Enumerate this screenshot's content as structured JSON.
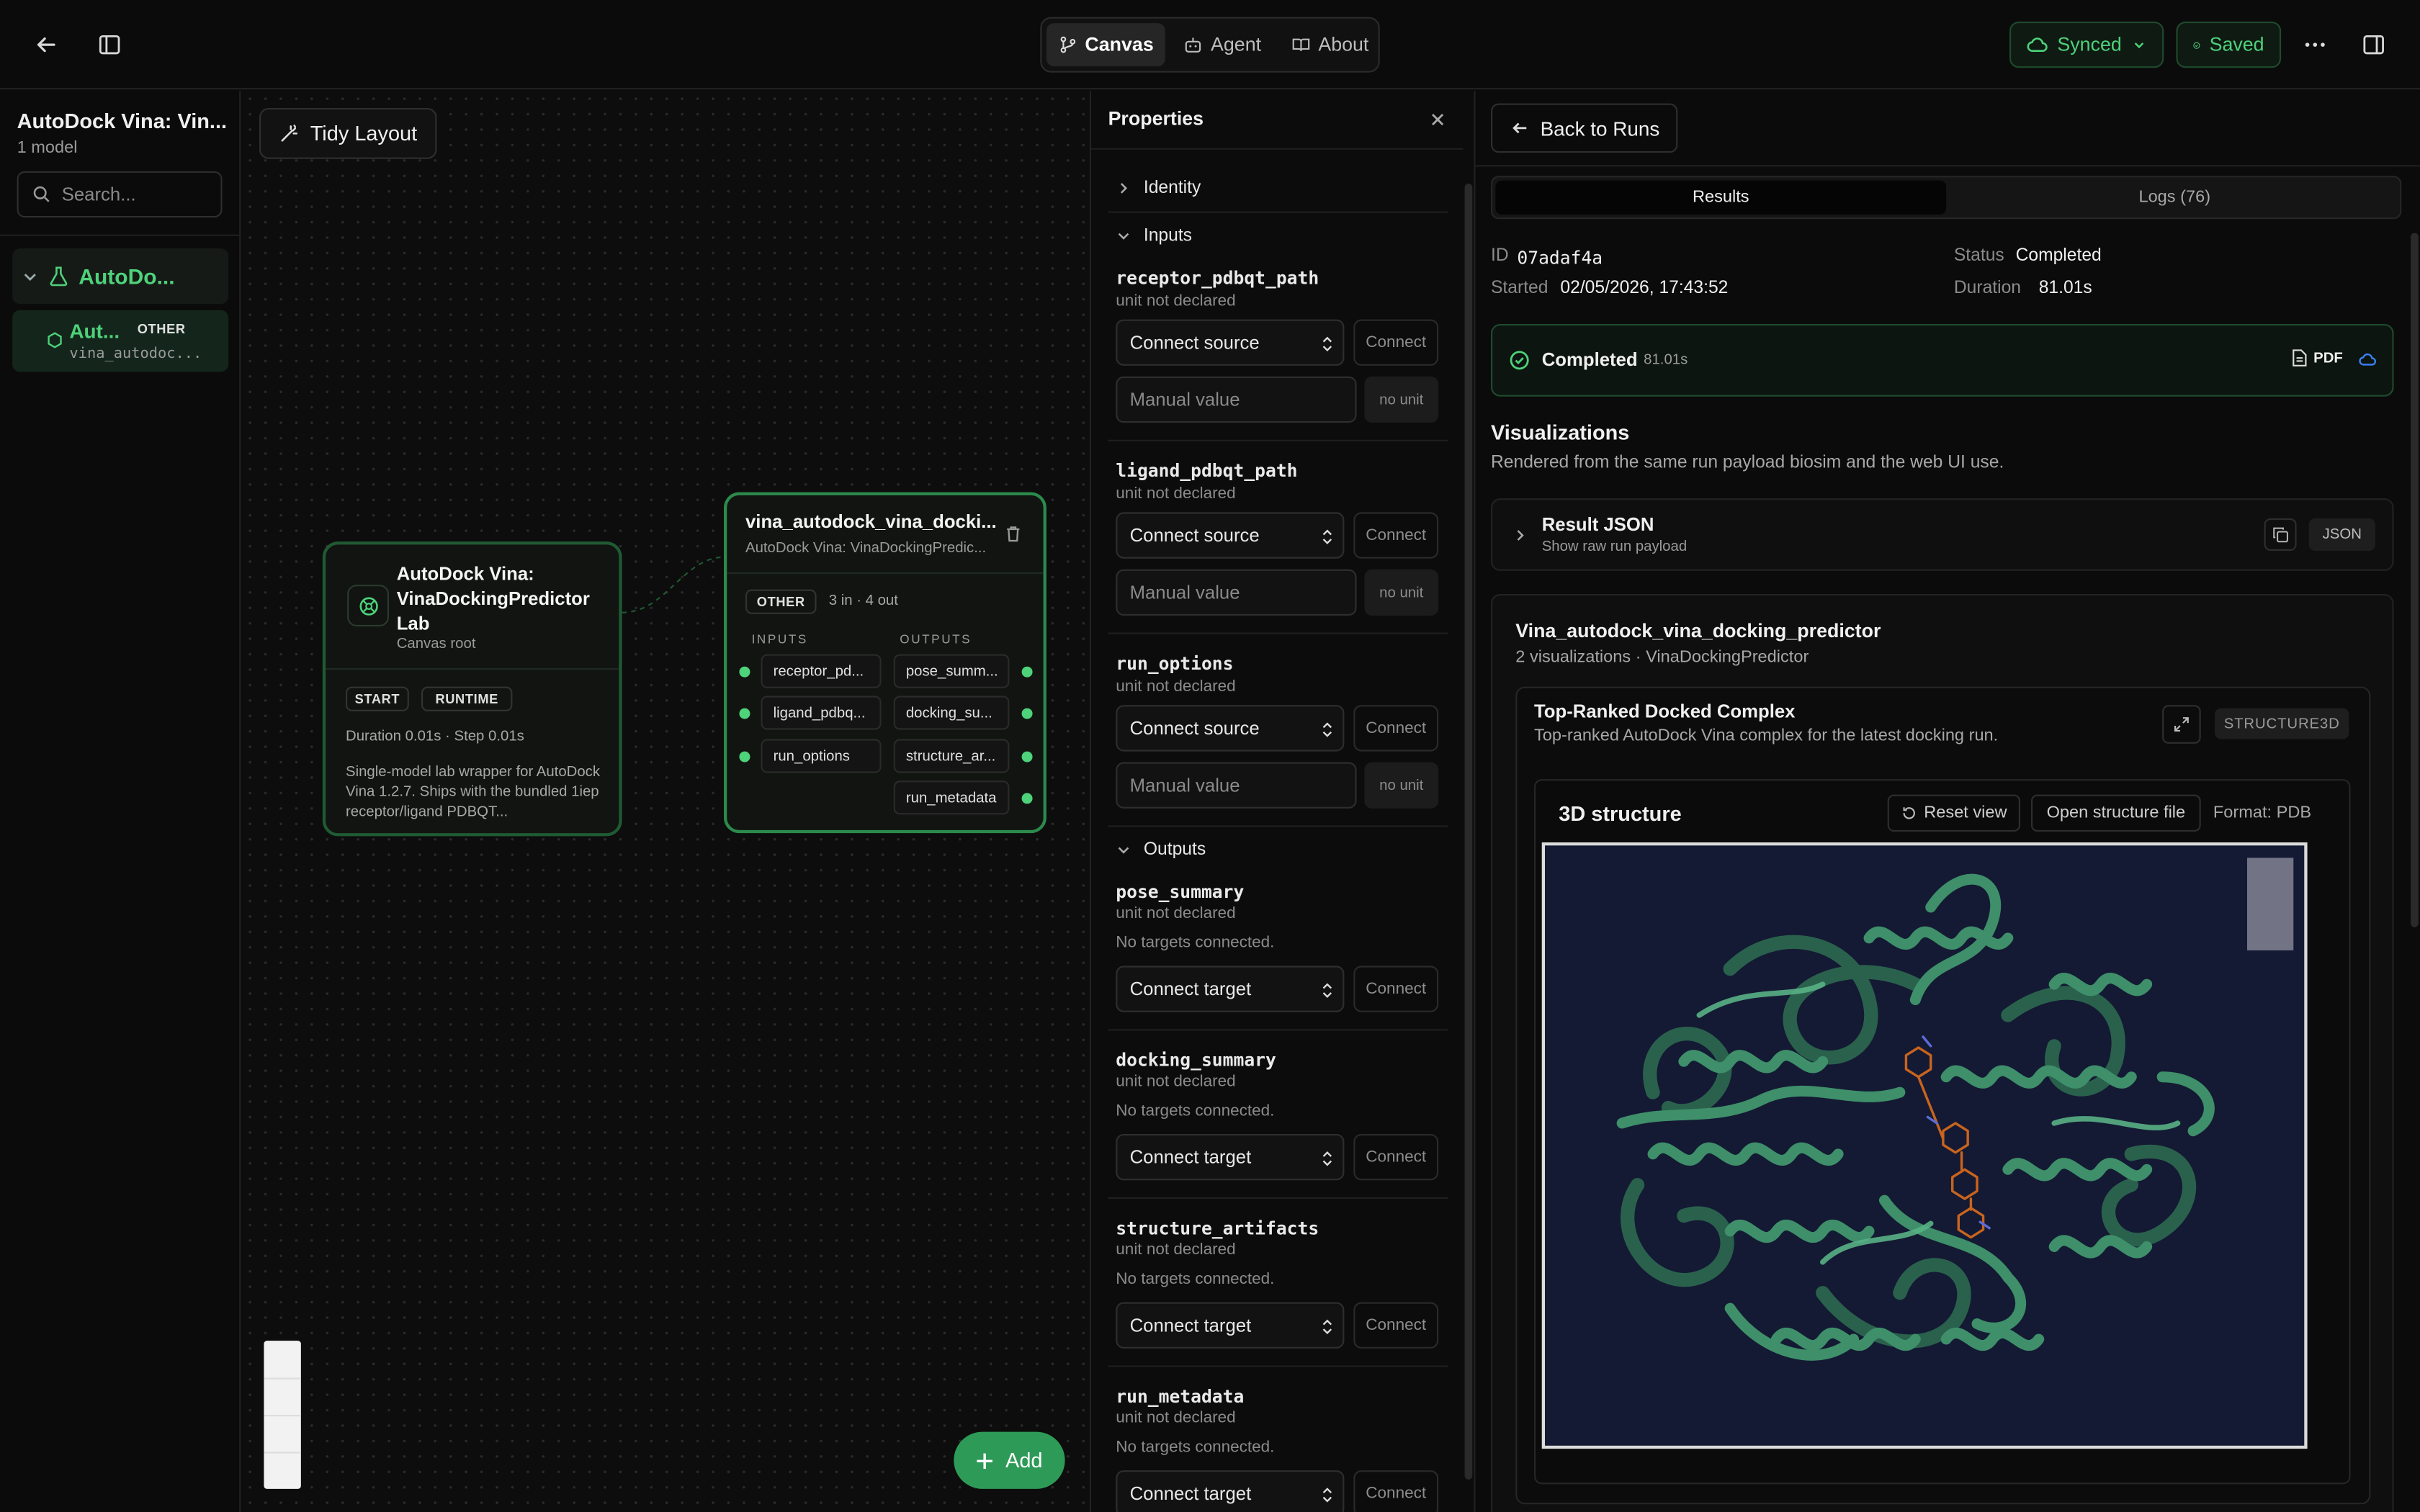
{
  "topbar": {
    "tabs": [
      {
        "label": "Canvas"
      },
      {
        "label": "Agent"
      },
      {
        "label": "About"
      }
    ],
    "synced": "Synced",
    "saved": "Saved"
  },
  "sidebar": {
    "title": "AutoDock Vina: Vin...",
    "subtitle": "1 model",
    "search_placeholder": "Search...",
    "group_label": "AutoDo...",
    "item_title": "Aut...",
    "item_badge": "OTHER",
    "item_sub": "vina_autodoc..."
  },
  "canvas": {
    "tidy": "Tidy Layout",
    "root_node": {
      "title": "AutoDock Vina: VinaDockingPredictor Lab",
      "subtitle": "Canvas root",
      "badges": [
        "START",
        "RUNTIME"
      ],
      "stats": "Duration 0.01s · Step 0.01s",
      "desc": "Single-model lab wrapper for AutoDock Vina 1.2.7. Ships with the bundled 1iep receptor/ligand PDBQT..."
    },
    "model_node": {
      "title": "vina_autodock_vina_docki...",
      "subtitle": "AutoDock Vina: VinaDockingPredic...",
      "badge": "OTHER",
      "io": "3 in · 4 out",
      "inputs_label": "INPUTS",
      "outputs_label": "OUTPUTS",
      "inputs": [
        "receptor_pd...",
        "ligand_pdbq...",
        "run_options"
      ],
      "outputs": [
        "pose_summ...",
        "docking_su...",
        "structure_ar...",
        "run_metadata"
      ]
    },
    "add": "Add"
  },
  "props": {
    "title": "Properties",
    "identity": "Identity",
    "inputs": "Inputs",
    "outputs": "Outputs",
    "input_fields": [
      {
        "name": "receptor_pdbqt_path",
        "unit": "unit not declared"
      },
      {
        "name": "ligand_pdbqt_path",
        "unit": "unit not declared"
      },
      {
        "name": "run_options",
        "unit": "unit not declared"
      }
    ],
    "output_fields": [
      {
        "name": "pose_summary",
        "unit": "unit not declared"
      },
      {
        "name": "docking_summary",
        "unit": "unit not declared"
      },
      {
        "name": "structure_artifacts",
        "unit": "unit not declared"
      },
      {
        "name": "run_metadata",
        "unit": "unit not declared"
      }
    ],
    "connect_source": "Connect source",
    "connect_target": "Connect target",
    "connect": "Connect",
    "manual_placeholder": "Manual value",
    "no_unit": "no unit",
    "no_targets": "No targets connected."
  },
  "results": {
    "back": "Back to Runs",
    "tab_results": "Results",
    "tab_logs": "Logs (76)",
    "id_label": "ID",
    "id": "07adaf4a",
    "started_label": "Started",
    "started": "02/05/2026, 17:43:52",
    "status_label": "Status",
    "status": "Completed",
    "duration_label": "Duration",
    "duration": "81.01s",
    "completed": "Completed",
    "completed_time": "81.01s",
    "pdf": "PDF",
    "viz_title": "Visualizations",
    "viz_sub": "Rendered from the same run payload biosim and the web UI use.",
    "json_title": "Result JSON",
    "json_sub": "Show raw run payload",
    "json_btn": "JSON",
    "model_title": "Vina_autodock_vina_docking_predictor",
    "model_sub": "2 visualizations · VinaDockingPredictor",
    "complex_title": "Top-Ranked Docked Complex",
    "complex_sub": "Top-ranked AutoDock Vina complex for the latest docking run.",
    "complex_badge": "STRUCTURE3D",
    "structure_title": "3D structure",
    "reset": "Reset view",
    "open_file": "Open structure file",
    "format": "Format: PDB"
  },
  "colors": {
    "accent": "#4ed27a",
    "protein": "#3e8f6a",
    "ligand": "#c8641e",
    "viewer_bg": "#141a33"
  }
}
